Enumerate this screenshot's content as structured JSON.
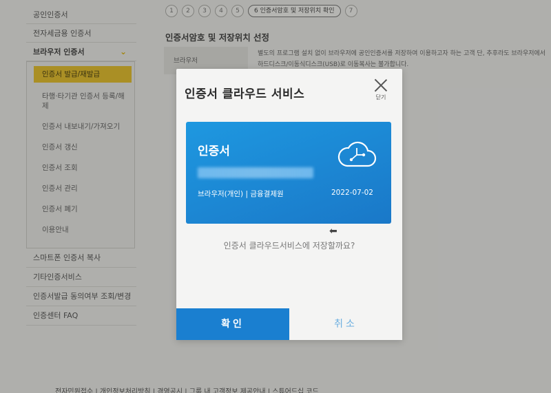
{
  "sidebar": {
    "top_items": [
      "공인인증서",
      "전자세금용 인증서"
    ],
    "open_section": "브라우저 인증서",
    "sub_items": [
      "인증서 발급/재발급",
      "타행·타기관 인증서 등록/해제",
      "인증서 내보내기/가져오기",
      "인증서 갱신",
      "인증서 조회",
      "인증서 관리",
      "인증서 폐기",
      "이용안내"
    ],
    "lower_items": [
      "스마트폰 인증서 복사",
      "기타인증서비스",
      "인증서발급 동의여부 조회/변경",
      "인증센터 FAQ"
    ]
  },
  "steps": {
    "items": [
      "1",
      "2",
      "3",
      "4",
      "5"
    ],
    "current": "6 인증서암호 및 저장위치 확인",
    "last": "7"
  },
  "content": {
    "title": "인증서암호 및 저장위치 선정",
    "field_label": "브라우저",
    "field_desc": "별도의 프로그램 설치 없이 브라우저에 공인인증서를 저장하여 이용하고자 하는 고객 단, 추후라도 브라우저에서 하드디스크/이동식디스크(USB)로 이동복사는 불가합니다."
  },
  "footer": {
    "links": "전자민원접수 | 개인정보처리방침 | 경영공시 | 그룹 내 고객정보 제공안내 | 스튜어드십 코드"
  },
  "modal": {
    "title": "인증서 클라우드 서비스",
    "close_label": "닫기",
    "card": {
      "name": "인증서",
      "meta": "브라우저(개인) | 금융결제원",
      "date": "2022-07-02",
      "icon": "cloud-icon"
    },
    "question": "인증서 클라우드서비스에 저장할까요?",
    "ok_label": "확인",
    "cancel_label": "취소"
  },
  "colors": {
    "card_blue": "#1a7fd0",
    "active_yellow": "#d4af1e",
    "cancel_text": "#6aaee0"
  }
}
